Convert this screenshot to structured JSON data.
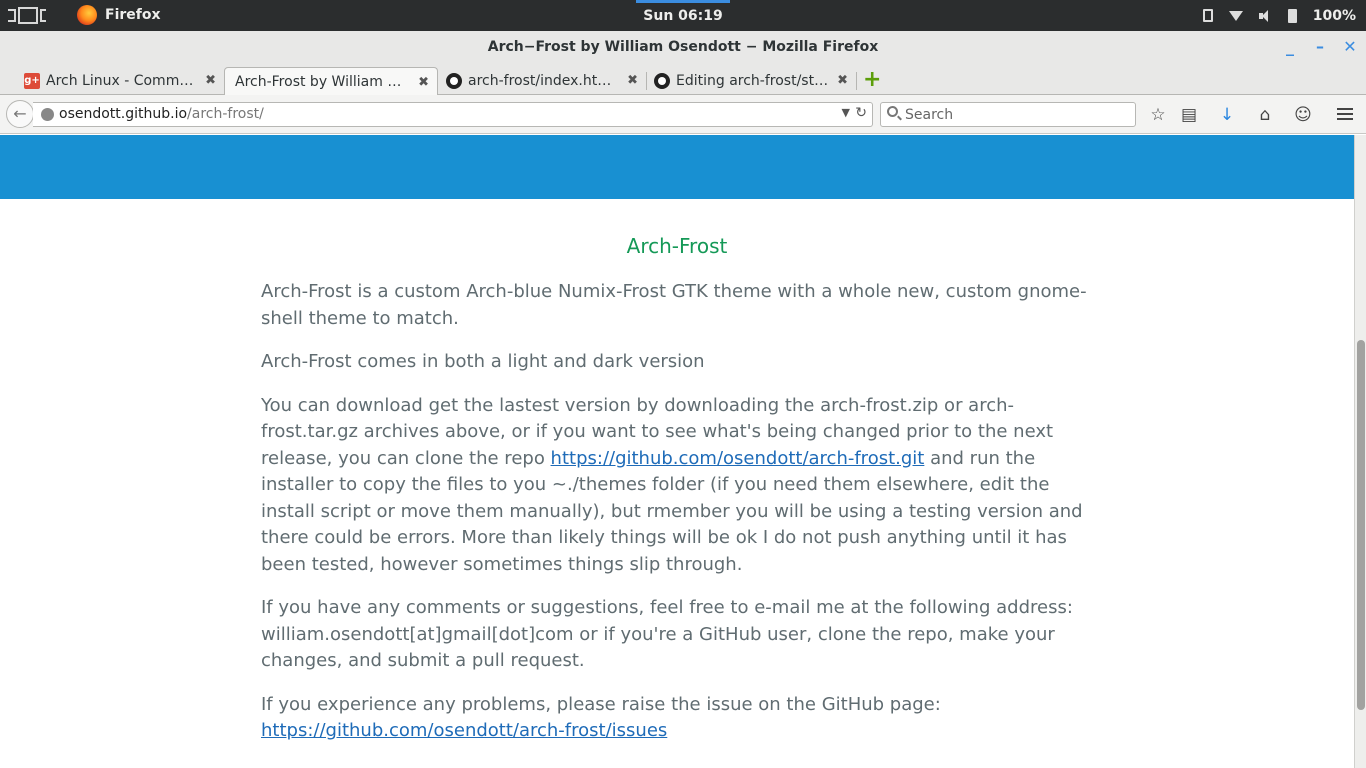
{
  "topbar": {
    "app_name": "Firefox",
    "clock": "Sun 06:19",
    "battery": "100%"
  },
  "window": {
    "title": "Arch−Frost by William Osendott − Mozilla Firefox",
    "minimize": "_",
    "maximize": "–",
    "close": "✕"
  },
  "tabs": [
    {
      "label": "Arch Linux - Commun...",
      "icon": "google-plus-icon"
    },
    {
      "label": "Arch-Frost by William Os...",
      "icon": "none",
      "active": true
    },
    {
      "label": "arch-frost/index.html...",
      "icon": "github-icon"
    },
    {
      "label": "Editing arch-frost/sty...",
      "icon": "github-icon"
    }
  ],
  "tab_close": "✖",
  "new_tab": "+",
  "navbar": {
    "url_host": "osendott.github.io",
    "url_path": "/arch-frost/",
    "search_placeholder": "Search"
  },
  "page": {
    "heading": "Arch-Frost",
    "p1": "Arch-Frost is a custom Arch-blue Numix-Frost GTK theme with a whole new, custom gnome-shell theme to match.",
    "p2": "Arch-Frost comes in both a light and dark version",
    "p3_before": "You can download get the lastest version by downloading the arch-frost.zip or arch-frost.tar.gz archives above, or if you want to see what's being changed prior to the next release, you can clone the repo ",
    "p3_link": "https://github.com/osendott/arch-frost.git",
    "p3_after": " and run the installer to copy the files to you ~./themes folder (if you need them elsewhere, edit the install script or move them manually), but rmember you will be using a testing version and there could be errors. More than likely things will be ok I do not push anything until it has been tested, however sometimes things slip through.",
    "p4": "If you have any comments or suggestions, feel free to e-mail me at the following address: william.osendott[at]gmail[dot]com or if you're a GitHub user, clone the repo, make your changes, and submit a pull request.",
    "p5_before": "If you experience any problems, please raise the issue on the GitHub page: ",
    "p5_link": "https://github.com/osendott/arch-frost/issues"
  },
  "colors": {
    "banner": "#1890d2",
    "heading": "#159957",
    "link": "#1e6bb8",
    "text": "#606c71"
  }
}
